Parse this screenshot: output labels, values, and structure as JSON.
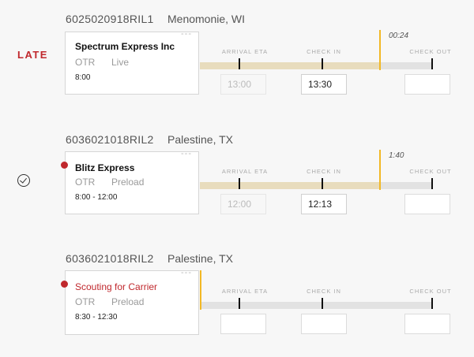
{
  "shipments": [
    {
      "status": "LATE",
      "load_id": "6025020918RIL1",
      "location": "Menomonie, WI",
      "carrier": "Spectrum Express Inc",
      "mode": "OTR",
      "load_type": "Live",
      "window": "8:00",
      "labels": {
        "arrival": "ARRIVAL ETA",
        "checkin": "CHECK IN",
        "checkout": "CHECK OUT"
      },
      "arrival_eta": "13:00",
      "check_in": "13:30",
      "check_out": "",
      "elapsed": "00:24",
      "card_menu": "---"
    },
    {
      "load_id": "6036021018RIL2",
      "location": "Palestine, TX",
      "carrier": "Blitz Express",
      "mode": "OTR",
      "load_type": "Preload",
      "window": "8:00 - 12:00",
      "labels": {
        "arrival": "ARRIVAL ETA",
        "checkin": "CHECK IN",
        "checkout": "CHECK OUT"
      },
      "arrival_eta": "12:00",
      "check_in": "12:13",
      "check_out": "",
      "elapsed": "1:40",
      "card_menu": "---"
    },
    {
      "load_id": "6036021018RIL2",
      "location": "Palestine, TX",
      "carrier": "Scouting for Carrier",
      "mode": "OTR",
      "load_type": "Preload",
      "window": "8:30 - 12:30",
      "labels": {
        "arrival": "ARRIVAL ETA",
        "checkin": "CHECK IN",
        "checkout": "CHECK OUT"
      },
      "arrival_eta": "",
      "check_in": "",
      "check_out": "",
      "card_menu": "---"
    }
  ],
  "colors": {
    "late": "#c0282d",
    "marker": "#f2b824",
    "progress_fill": "#e8dcbd",
    "track": "#e2e2e2"
  },
  "icons": {
    "completed": "check-circle-icon",
    "alert": "red-dot-icon"
  }
}
